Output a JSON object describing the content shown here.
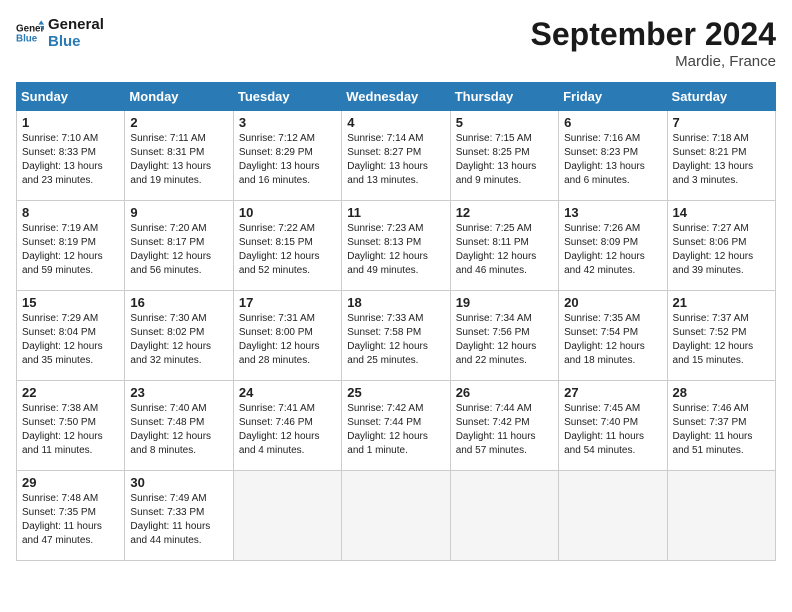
{
  "header": {
    "logo_line1": "General",
    "logo_line2": "Blue",
    "month_title": "September 2024",
    "location": "Mardie, France"
  },
  "weekdays": [
    "Sunday",
    "Monday",
    "Tuesday",
    "Wednesday",
    "Thursday",
    "Friday",
    "Saturday"
  ],
  "days": [
    {
      "num": "",
      "info": ""
    },
    {
      "num": "1",
      "info": "Sunrise: 7:10 AM\nSunset: 8:33 PM\nDaylight: 13 hours\nand 23 minutes."
    },
    {
      "num": "2",
      "info": "Sunrise: 7:11 AM\nSunset: 8:31 PM\nDaylight: 13 hours\nand 19 minutes."
    },
    {
      "num": "3",
      "info": "Sunrise: 7:12 AM\nSunset: 8:29 PM\nDaylight: 13 hours\nand 16 minutes."
    },
    {
      "num": "4",
      "info": "Sunrise: 7:14 AM\nSunset: 8:27 PM\nDaylight: 13 hours\nand 13 minutes."
    },
    {
      "num": "5",
      "info": "Sunrise: 7:15 AM\nSunset: 8:25 PM\nDaylight: 13 hours\nand 9 minutes."
    },
    {
      "num": "6",
      "info": "Sunrise: 7:16 AM\nSunset: 8:23 PM\nDaylight: 13 hours\nand 6 minutes."
    },
    {
      "num": "7",
      "info": "Sunrise: 7:18 AM\nSunset: 8:21 PM\nDaylight: 13 hours\nand 3 minutes."
    },
    {
      "num": "8",
      "info": "Sunrise: 7:19 AM\nSunset: 8:19 PM\nDaylight: 12 hours\nand 59 minutes."
    },
    {
      "num": "9",
      "info": "Sunrise: 7:20 AM\nSunset: 8:17 PM\nDaylight: 12 hours\nand 56 minutes."
    },
    {
      "num": "10",
      "info": "Sunrise: 7:22 AM\nSunset: 8:15 PM\nDaylight: 12 hours\nand 52 minutes."
    },
    {
      "num": "11",
      "info": "Sunrise: 7:23 AM\nSunset: 8:13 PM\nDaylight: 12 hours\nand 49 minutes."
    },
    {
      "num": "12",
      "info": "Sunrise: 7:25 AM\nSunset: 8:11 PM\nDaylight: 12 hours\nand 46 minutes."
    },
    {
      "num": "13",
      "info": "Sunrise: 7:26 AM\nSunset: 8:09 PM\nDaylight: 12 hours\nand 42 minutes."
    },
    {
      "num": "14",
      "info": "Sunrise: 7:27 AM\nSunset: 8:06 PM\nDaylight: 12 hours\nand 39 minutes."
    },
    {
      "num": "15",
      "info": "Sunrise: 7:29 AM\nSunset: 8:04 PM\nDaylight: 12 hours\nand 35 minutes."
    },
    {
      "num": "16",
      "info": "Sunrise: 7:30 AM\nSunset: 8:02 PM\nDaylight: 12 hours\nand 32 minutes."
    },
    {
      "num": "17",
      "info": "Sunrise: 7:31 AM\nSunset: 8:00 PM\nDaylight: 12 hours\nand 28 minutes."
    },
    {
      "num": "18",
      "info": "Sunrise: 7:33 AM\nSunset: 7:58 PM\nDaylight: 12 hours\nand 25 minutes."
    },
    {
      "num": "19",
      "info": "Sunrise: 7:34 AM\nSunset: 7:56 PM\nDaylight: 12 hours\nand 22 minutes."
    },
    {
      "num": "20",
      "info": "Sunrise: 7:35 AM\nSunset: 7:54 PM\nDaylight: 12 hours\nand 18 minutes."
    },
    {
      "num": "21",
      "info": "Sunrise: 7:37 AM\nSunset: 7:52 PM\nDaylight: 12 hours\nand 15 minutes."
    },
    {
      "num": "22",
      "info": "Sunrise: 7:38 AM\nSunset: 7:50 PM\nDaylight: 12 hours\nand 11 minutes."
    },
    {
      "num": "23",
      "info": "Sunrise: 7:40 AM\nSunset: 7:48 PM\nDaylight: 12 hours\nand 8 minutes."
    },
    {
      "num": "24",
      "info": "Sunrise: 7:41 AM\nSunset: 7:46 PM\nDaylight: 12 hours\nand 4 minutes."
    },
    {
      "num": "25",
      "info": "Sunrise: 7:42 AM\nSunset: 7:44 PM\nDaylight: 12 hours\nand 1 minute."
    },
    {
      "num": "26",
      "info": "Sunrise: 7:44 AM\nSunset: 7:42 PM\nDaylight: 11 hours\nand 57 minutes."
    },
    {
      "num": "27",
      "info": "Sunrise: 7:45 AM\nSunset: 7:40 PM\nDaylight: 11 hours\nand 54 minutes."
    },
    {
      "num": "28",
      "info": "Sunrise: 7:46 AM\nSunset: 7:37 PM\nDaylight: 11 hours\nand 51 minutes."
    },
    {
      "num": "29",
      "info": "Sunrise: 7:48 AM\nSunset: 7:35 PM\nDaylight: 11 hours\nand 47 minutes."
    },
    {
      "num": "30",
      "info": "Sunrise: 7:49 AM\nSunset: 7:33 PM\nDaylight: 11 hours\nand 44 minutes."
    },
    {
      "num": "",
      "info": ""
    },
    {
      "num": "",
      "info": ""
    },
    {
      "num": "",
      "info": ""
    },
    {
      "num": "",
      "info": ""
    },
    {
      "num": "",
      "info": ""
    }
  ]
}
